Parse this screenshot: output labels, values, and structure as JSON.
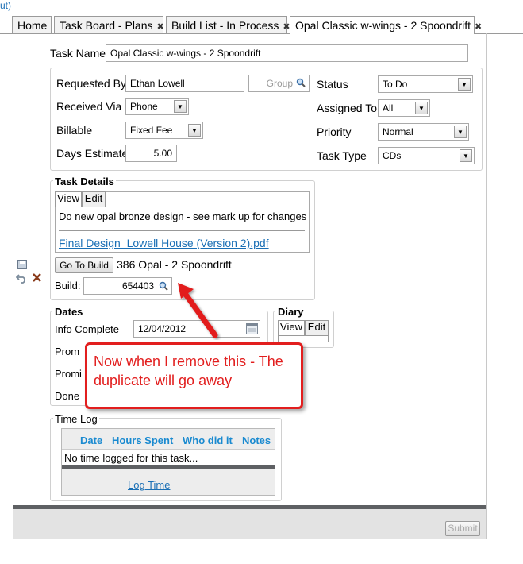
{
  "top_stub": "ut)",
  "tabs": [
    {
      "label": "Home",
      "closable": false
    },
    {
      "label": "Task Board - Plans",
      "closable": true
    },
    {
      "label": "Build List - In Process",
      "closable": true
    },
    {
      "label": "Opal Classic w-wings - 2 Spoondrift",
      "closable": true
    }
  ],
  "tab_close_glyph": "✖",
  "task_name": {
    "label": "Task Name",
    "value": "Opal Classic w-wings - 2 Spoondrift"
  },
  "requested_by": {
    "label": "Requested By",
    "value": "Ethan Lowell",
    "group_placeholder": "Group"
  },
  "received_via": {
    "label": "Received Via",
    "value": "Phone"
  },
  "billable": {
    "label": "Billable",
    "value": "Fixed Fee"
  },
  "days_estimate": {
    "label": "Days Estimate",
    "value": "5.00"
  },
  "status": {
    "label": "Status",
    "value": "To Do"
  },
  "assigned_to": {
    "label": "Assigned To",
    "value": "All"
  },
  "priority": {
    "label": "Priority",
    "value": "Normal"
  },
  "task_type": {
    "label": "Task Type",
    "value": "CDs"
  },
  "task_details": {
    "legend": "Task Details",
    "view_tab": "View",
    "edit_tab": "Edit",
    "description": "Do new opal bronze design - see mark up for changes",
    "attachment": "Final Design_Lowell House (Version 2).pdf",
    "go_to_build": "Go To Build",
    "build_name": "386 Opal - 2 Spoondrift",
    "build_label": "Build:",
    "build_value": "654403"
  },
  "dates": {
    "legend": "Dates",
    "info_complete_label": "Info Complete",
    "info_complete_value": "12/04/2012",
    "row2_label": "Prom",
    "row3_label": "Promi",
    "row4_label": "Done"
  },
  "diary": {
    "legend": "Diary",
    "view_tab": "View",
    "edit_tab": "Edit"
  },
  "callout": {
    "text": "Now when I remove this - The duplicate will go away",
    "color": "#e21e1e"
  },
  "time_log": {
    "legend": "Time Log",
    "columns": [
      "Date",
      "Hours Spent",
      "Who did it",
      "Notes"
    ],
    "empty_text": "No time logged for this task...",
    "log_time": "Log Time"
  },
  "submit_label": "Submit",
  "icons": {
    "save": "save-icon",
    "undo": "undo-icon",
    "delete": "delete-icon",
    "search": "magnifier-icon",
    "calendar": "calendar-icon"
  }
}
